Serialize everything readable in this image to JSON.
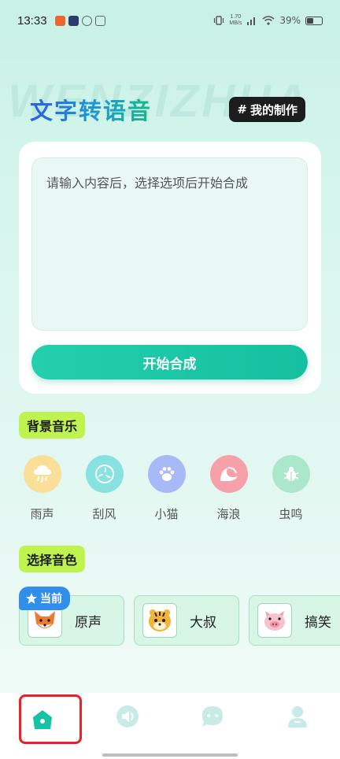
{
  "status_bar": {
    "time": "13:33",
    "net_speed_value": "1.70",
    "net_speed_unit": "MB/s",
    "battery_percent": "39%",
    "battery_level": 0.39
  },
  "watermark": "WENZIZHUA",
  "header": {
    "title": "文字转语音",
    "my_works_label": "我的制作",
    "my_works_prefix": "#"
  },
  "editor": {
    "placeholder": "请输入内容后，选择选项后开始合成",
    "start_label": "开始合成"
  },
  "background_music": {
    "section_label": "背景音乐",
    "items": [
      {
        "label": "雨声",
        "icon": "rain-cloud-icon",
        "color": "#f9df97"
      },
      {
        "label": "刮风",
        "icon": "fan-icon",
        "color": "#87e2e0"
      },
      {
        "label": "小猫",
        "icon": "paw-icon",
        "color": "#a7b9f6"
      },
      {
        "label": "海浪",
        "icon": "wave-icon",
        "color": "#f6a1aa"
      },
      {
        "label": "虫鸣",
        "icon": "bug-icon",
        "color": "#abe7cb"
      }
    ]
  },
  "voice": {
    "section_label": "选择音色",
    "current_badge": "当前",
    "items": [
      {
        "label": "原声",
        "icon": "fox-avatar-icon"
      },
      {
        "label": "大叔",
        "icon": "tiger-avatar-icon"
      },
      {
        "label": "搞笑",
        "icon": "pig-avatar-icon"
      }
    ]
  },
  "bottom_nav": {
    "items": [
      {
        "name": "home",
        "icon": "home-icon",
        "active": true
      },
      {
        "name": "audio",
        "icon": "speaker-icon"
      },
      {
        "name": "chat",
        "icon": "chat-bubble-icon"
      },
      {
        "name": "profile",
        "icon": "person-icon"
      }
    ]
  },
  "colors": {
    "accent": "#14c09f",
    "tag": "#bff44f",
    "badge": "#2f8fea",
    "highlight": "#e8212b"
  }
}
